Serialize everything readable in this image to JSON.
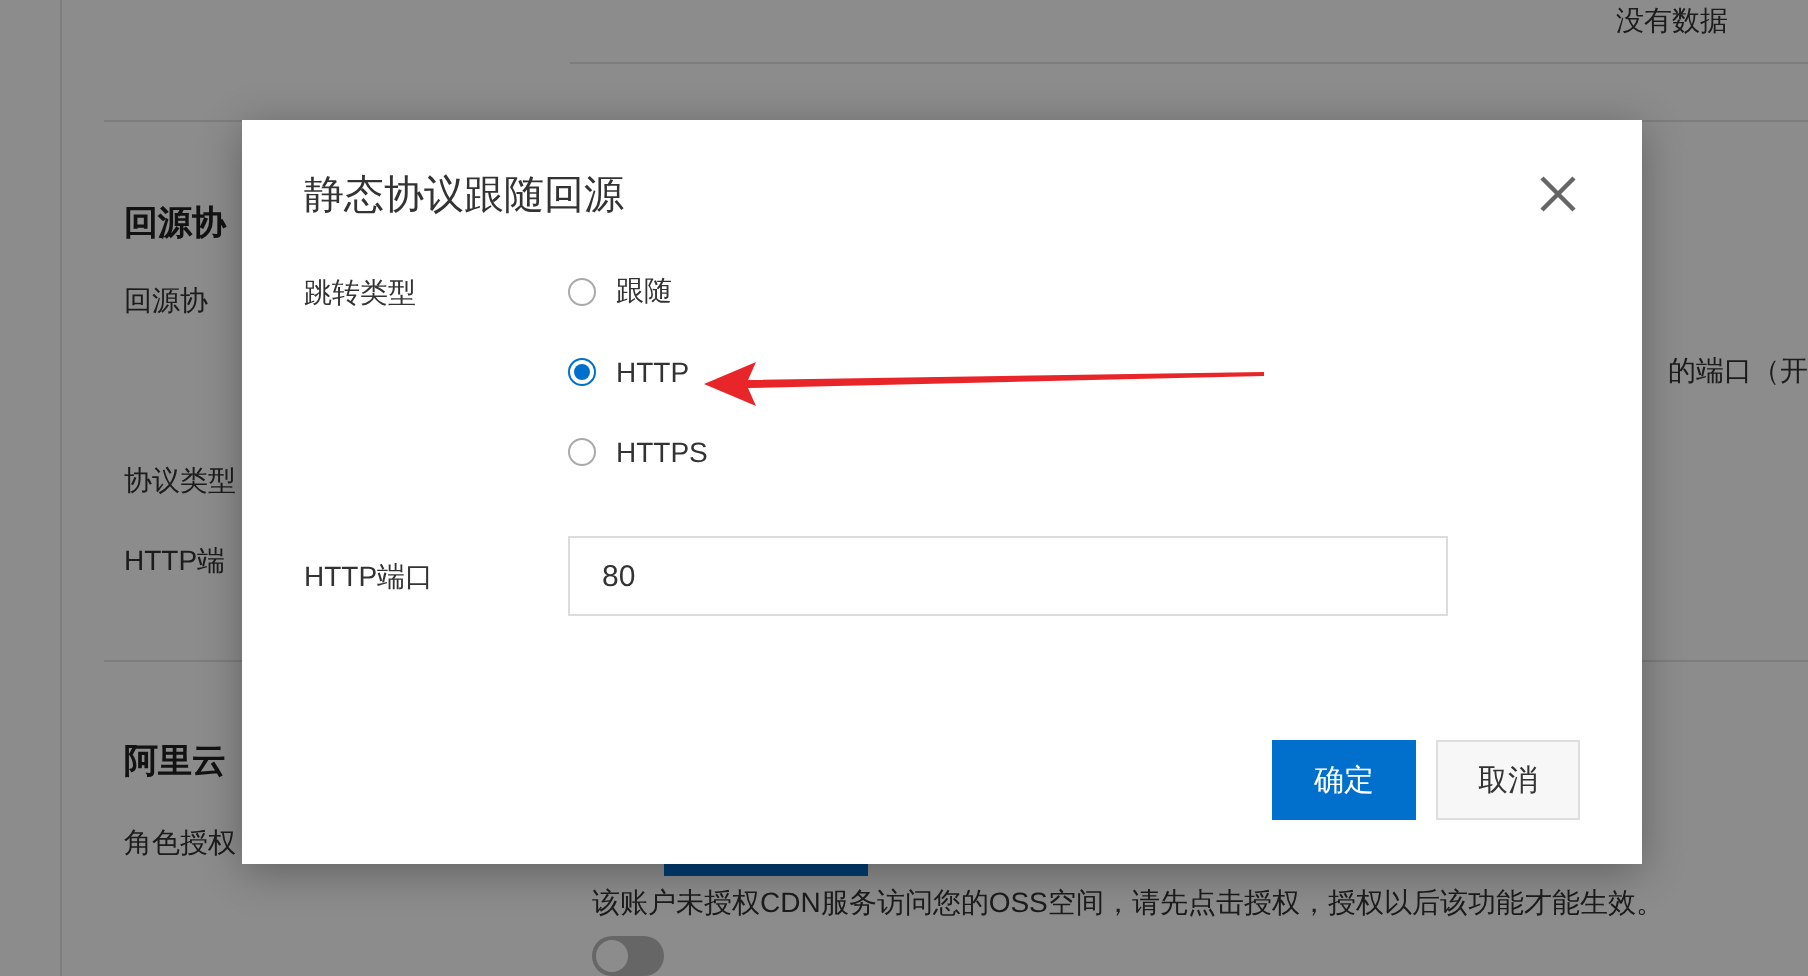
{
  "background": {
    "empty_text": "没有数据",
    "section_1": {
      "heading": "回源协",
      "label": "回源协",
      "side_text": "的端口（开",
      "protocol_label": "协议类型",
      "port_label": "HTTP端"
    },
    "section_2": {
      "heading": "阿里云",
      "role_label": "角色授权",
      "hint": "该账户未授权CDN服务访问您的OSS空间，请先点击授权，授权以后该功能才能生效。",
      "switch": {
        "on": false
      }
    }
  },
  "dialog": {
    "title": "静态协议跟随回源",
    "jump_type_label": "跳转类型",
    "options": [
      {
        "label": "跟随",
        "selected": false
      },
      {
        "label": "HTTP",
        "selected": true
      },
      {
        "label": "HTTPS",
        "selected": false
      }
    ],
    "port_label": "HTTP端口",
    "port_value": "80",
    "buttons": [
      {
        "label": "确定",
        "kind": "primary"
      },
      {
        "label": "取消",
        "kind": "secondary"
      }
    ]
  }
}
